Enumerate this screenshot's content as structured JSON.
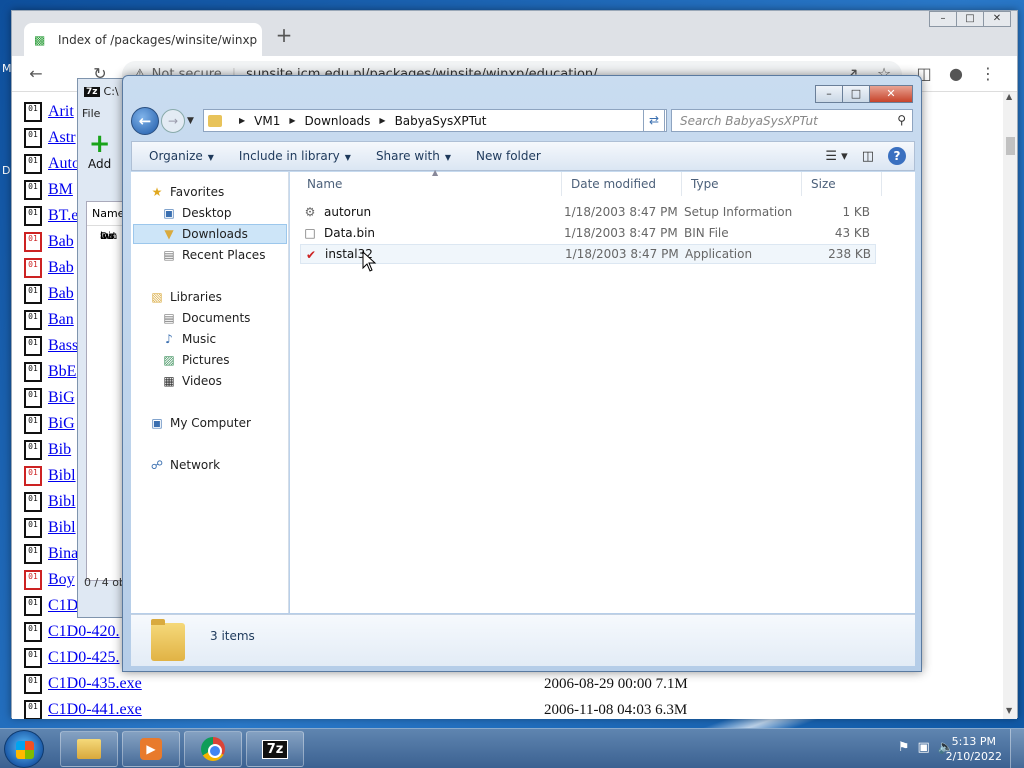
{
  "desktop": {
    "labels": [
      "M",
      "D"
    ]
  },
  "chrome": {
    "tab_title": "Index of /packages/winsite/winxp",
    "new_tab": "+",
    "url_prefix": "Not secure",
    "url": "sunsite.icm.edu.pl/packages/winsite/winxp/education/",
    "window_buttons": [
      "–",
      "□",
      "✕"
    ],
    "files": [
      {
        "name": "Arit",
        "red": false
      },
      {
        "name": "Astr",
        "red": false
      },
      {
        "name": "Auto",
        "red": false
      },
      {
        "name": "BM",
        "red": false
      },
      {
        "name": "BT.e",
        "red": false
      },
      {
        "name": "Bab",
        "red": true
      },
      {
        "name": "Bab",
        "red": true
      },
      {
        "name": "Bab",
        "red": false
      },
      {
        "name": "Ban",
        "red": false
      },
      {
        "name": "Bass",
        "red": false
      },
      {
        "name": "BbE",
        "red": false
      },
      {
        "name": "BiG",
        "red": false
      },
      {
        "name": "BiG",
        "red": false
      },
      {
        "name": "Bib",
        "red": false
      },
      {
        "name": "Bibl",
        "red": true
      },
      {
        "name": "Bibl",
        "red": false
      },
      {
        "name": "Bibl",
        "red": false
      },
      {
        "name": "Bina",
        "red": false
      },
      {
        "name": "Boy",
        "red": true
      },
      {
        "name": "C1D",
        "red": false
      },
      {
        "name": "C1D0-420.",
        "red": false
      },
      {
        "name": "C1D0-425.",
        "red": false
      },
      {
        "name": "C1D0-435.exe",
        "red": false,
        "meta": "2006-08-29 00:00  7.1M"
      },
      {
        "name": "C1D0-441.exe",
        "red": false,
        "meta": "2006-11-08 04:03  6.3M"
      }
    ]
  },
  "sevenzip": {
    "title": "C:\\",
    "logo": "7z",
    "menu": "File",
    "add_label": "Add",
    "list_header": "Name",
    "rows": [
      "win",
      "aut",
      "Da",
      "ins"
    ],
    "status": "0 / 4 ob"
  },
  "explorer": {
    "breadcrumb": [
      "VM1",
      "Downloads",
      "BabyaSysXPTut"
    ],
    "search_placeholder": "Search BabyaSysXPTut",
    "commands": {
      "organize": "Organize",
      "include_in_library": "Include in library",
      "share_with": "Share with",
      "new_folder": "New folder"
    },
    "nav": {
      "favorites": "Favorites",
      "desktop": "Desktop",
      "downloads": "Downloads",
      "recent_places": "Recent Places",
      "libraries": "Libraries",
      "documents": "Documents",
      "music": "Music",
      "pictures": "Pictures",
      "videos": "Videos",
      "my_computer": "My Computer",
      "network": "Network"
    },
    "columns": {
      "name": "Name",
      "date": "Date modified",
      "type": "Type",
      "size": "Size"
    },
    "files": [
      {
        "name": "autorun",
        "date": "1/18/2003 8:47 PM",
        "type": "Setup Information",
        "size": "1 KB",
        "icon": "settings-file-icon"
      },
      {
        "name": "Data.bin",
        "date": "1/18/2003 8:47 PM",
        "type": "BIN File",
        "size": "43 KB",
        "icon": "file-icon"
      },
      {
        "name": "instal32",
        "date": "1/18/2003 8:47 PM",
        "type": "Application",
        "size": "238 KB",
        "icon": "application-icon"
      }
    ],
    "items_count": "3 items"
  },
  "taskbar": {
    "time": "5:13 PM",
    "date": "2/10/2022",
    "sevenzip_label": "7z"
  }
}
